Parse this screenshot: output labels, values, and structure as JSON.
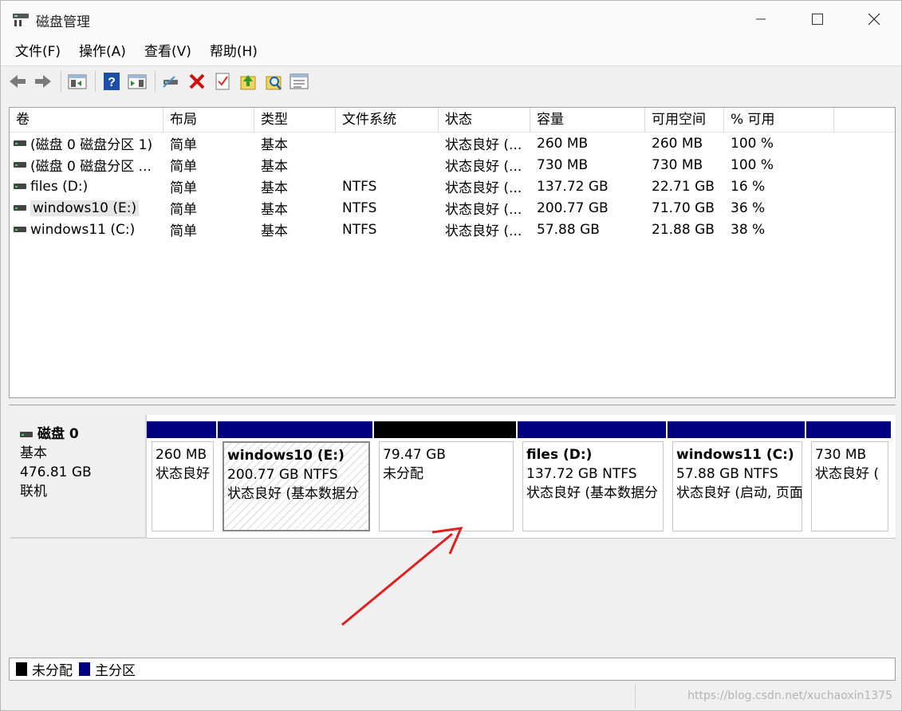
{
  "window": {
    "title": "磁盘管理"
  },
  "menu": [
    "文件(F)",
    "操作(A)",
    "查看(V)",
    "帮助(H)"
  ],
  "toolbar": [
    "back-icon",
    "forward-icon",
    "show-hide-console-icon",
    "help-icon",
    "action-pane-icon",
    "connect-disk-icon",
    "delete-icon",
    "check-icon",
    "import-icon",
    "search-icon",
    "properties-icon"
  ],
  "columns": [
    "卷",
    "布局",
    "类型",
    "文件系统",
    "状态",
    "容量",
    "可用空间",
    "% 可用"
  ],
  "volumes": [
    {
      "name": "(磁盘 0 磁盘分区 1)",
      "layout": "简单",
      "type": "基本",
      "fs": "",
      "status": "状态良好 (...",
      "capacity": "260 MB",
      "free": "260 MB",
      "pct": "100 %"
    },
    {
      "name": "(磁盘 0 磁盘分区 ...",
      "layout": "简单",
      "type": "基本",
      "fs": "",
      "status": "状态良好 (...",
      "capacity": "730 MB",
      "free": "730 MB",
      "pct": "100 %"
    },
    {
      "name": "files (D:)",
      "layout": "简单",
      "type": "基本",
      "fs": "NTFS",
      "status": "状态良好 (...",
      "capacity": "137.72 GB",
      "free": "22.71 GB",
      "pct": "16 %"
    },
    {
      "name": "windows10 (E:)",
      "layout": "简单",
      "type": "基本",
      "fs": "NTFS",
      "status": "状态良好 (...",
      "capacity": "200.77 GB",
      "free": "71.70 GB",
      "pct": "36 %"
    },
    {
      "name": "windows11 (C:)",
      "layout": "简单",
      "type": "基本",
      "fs": "NTFS",
      "status": "状态良好 (...",
      "capacity": "57.88 GB",
      "free": "21.88 GB",
      "pct": "38 %"
    }
  ],
  "disk": {
    "name": "磁盘 0",
    "type": "基本",
    "size": "476.81 GB",
    "state": "联机",
    "partitions": [
      {
        "title": "",
        "line1": "260 MB",
        "line2": "状态良好",
        "bar": "primary"
      },
      {
        "title": "windows10  (E:)",
        "line1": "200.77 GB NTFS",
        "line2": "状态良好 (基本数据分",
        "bar": "primary"
      },
      {
        "title": "",
        "line1": "79.47 GB",
        "line2": "未分配",
        "bar": "unallocated"
      },
      {
        "title": "files  (D:)",
        "line1": "137.72 GB NTFS",
        "line2": "状态良好 (基本数据分",
        "bar": "primary"
      },
      {
        "title": "windows11  (C:)",
        "line1": "57.88 GB NTFS",
        "line2": "状态良好 (启动, 页面",
        "bar": "primary"
      },
      {
        "title": "",
        "line1": "730 MB",
        "line2": "状态良好 (",
        "bar": "primary"
      }
    ]
  },
  "legend": [
    {
      "label": "未分配",
      "color": "#000000"
    },
    {
      "label": "主分区",
      "color": "#000080"
    }
  ],
  "watermark": "https://blog.csdn.net/xuchaoxin1375"
}
